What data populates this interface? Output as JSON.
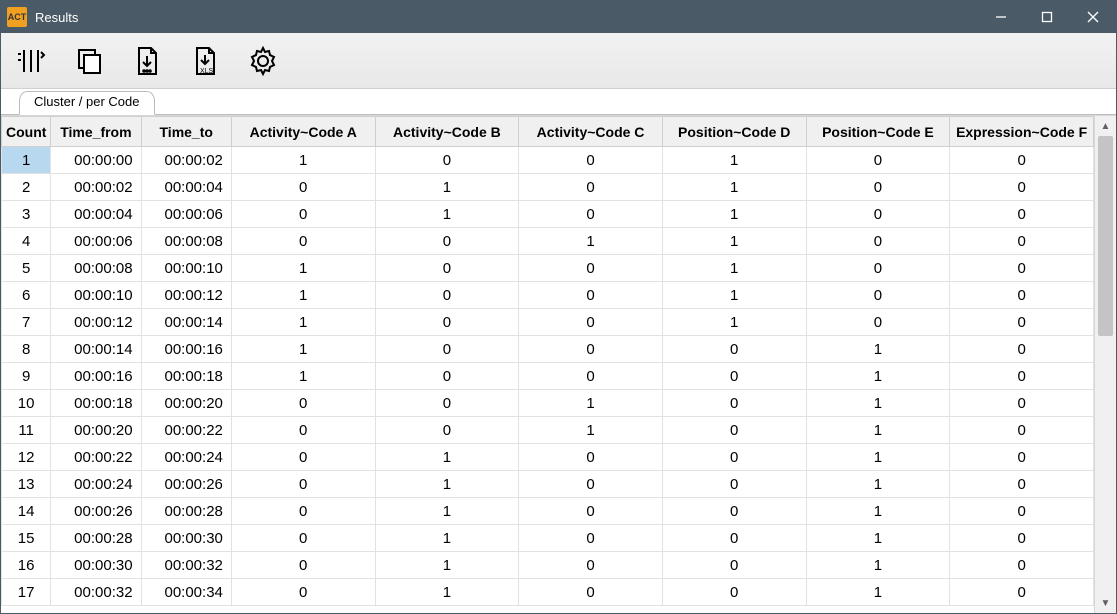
{
  "window_title": "Results",
  "app_icon_text": "ACT",
  "tab_label": "Cluster / per Code",
  "columns": [
    "Count",
    "Time_from",
    "Time_to",
    "Activity~Code A",
    "Activity~Code B",
    "Activity~Code C",
    "Position~Code D",
    "Position~Code E",
    "Expression~Code F"
  ],
  "rows": [
    {
      "count": "1",
      "from": "00:00:00",
      "to": "00:00:02",
      "a": "1",
      "b": "0",
      "c": "0",
      "d": "1",
      "e": "0",
      "f": "0",
      "selected": true
    },
    {
      "count": "2",
      "from": "00:00:02",
      "to": "00:00:04",
      "a": "0",
      "b": "1",
      "c": "0",
      "d": "1",
      "e": "0",
      "f": "0"
    },
    {
      "count": "3",
      "from": "00:00:04",
      "to": "00:00:06",
      "a": "0",
      "b": "1",
      "c": "0",
      "d": "1",
      "e": "0",
      "f": "0"
    },
    {
      "count": "4",
      "from": "00:00:06",
      "to": "00:00:08",
      "a": "0",
      "b": "0",
      "c": "1",
      "d": "1",
      "e": "0",
      "f": "0"
    },
    {
      "count": "5",
      "from": "00:00:08",
      "to": "00:00:10",
      "a": "1",
      "b": "0",
      "c": "0",
      "d": "1",
      "e": "0",
      "f": "0"
    },
    {
      "count": "6",
      "from": "00:00:10",
      "to": "00:00:12",
      "a": "1",
      "b": "0",
      "c": "0",
      "d": "1",
      "e": "0",
      "f": "0"
    },
    {
      "count": "7",
      "from": "00:00:12",
      "to": "00:00:14",
      "a": "1",
      "b": "0",
      "c": "0",
      "d": "1",
      "e": "0",
      "f": "0"
    },
    {
      "count": "8",
      "from": "00:00:14",
      "to": "00:00:16",
      "a": "1",
      "b": "0",
      "c": "0",
      "d": "0",
      "e": "1",
      "f": "0"
    },
    {
      "count": "9",
      "from": "00:00:16",
      "to": "00:00:18",
      "a": "1",
      "b": "0",
      "c": "0",
      "d": "0",
      "e": "1",
      "f": "0"
    },
    {
      "count": "10",
      "from": "00:00:18",
      "to": "00:00:20",
      "a": "0",
      "b": "0",
      "c": "1",
      "d": "0",
      "e": "1",
      "f": "0"
    },
    {
      "count": "11",
      "from": "00:00:20",
      "to": "00:00:22",
      "a": "0",
      "b": "0",
      "c": "1",
      "d": "0",
      "e": "1",
      "f": "0"
    },
    {
      "count": "12",
      "from": "00:00:22",
      "to": "00:00:24",
      "a": "0",
      "b": "1",
      "c": "0",
      "d": "0",
      "e": "1",
      "f": "0"
    },
    {
      "count": "13",
      "from": "00:00:24",
      "to": "00:00:26",
      "a": "0",
      "b": "1",
      "c": "0",
      "d": "0",
      "e": "1",
      "f": "0"
    },
    {
      "count": "14",
      "from": "00:00:26",
      "to": "00:00:28",
      "a": "0",
      "b": "1",
      "c": "0",
      "d": "0",
      "e": "1",
      "f": "0"
    },
    {
      "count": "15",
      "from": "00:00:28",
      "to": "00:00:30",
      "a": "0",
      "b": "1",
      "c": "0",
      "d": "0",
      "e": "1",
      "f": "0"
    },
    {
      "count": "16",
      "from": "00:00:30",
      "to": "00:00:32",
      "a": "0",
      "b": "1",
      "c": "0",
      "d": "0",
      "e": "1",
      "f": "0"
    },
    {
      "count": "17",
      "from": "00:00:32",
      "to": "00:00:34",
      "a": "0",
      "b": "1",
      "c": "0",
      "d": "0",
      "e": "1",
      "f": "0"
    }
  ]
}
